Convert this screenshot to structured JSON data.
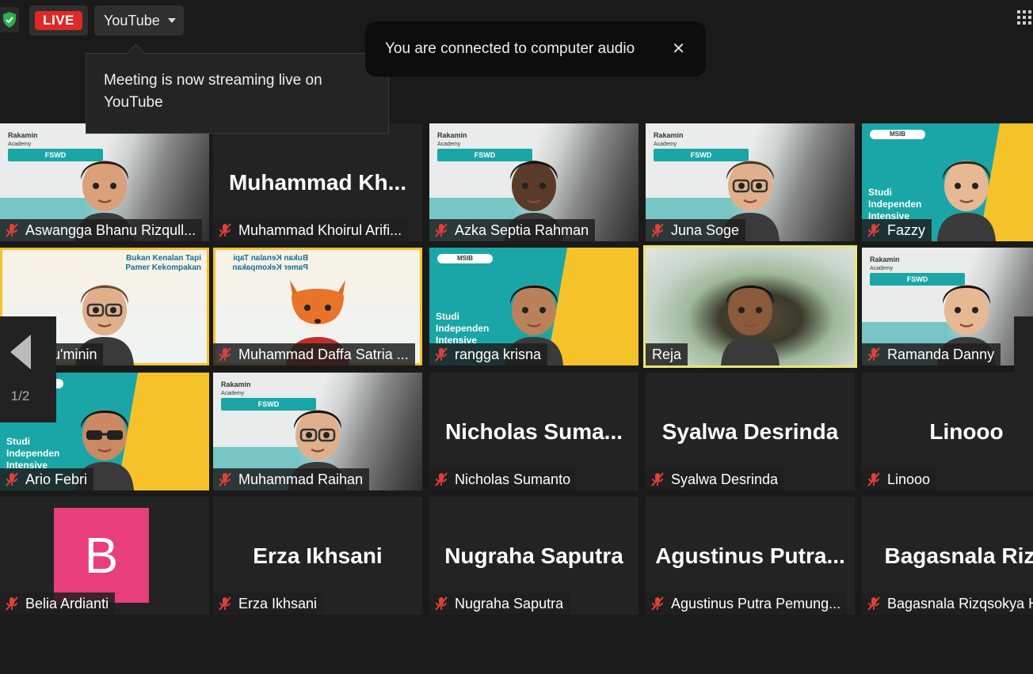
{
  "topbar": {
    "live_label": "LIVE",
    "stream_target": "YouTube"
  },
  "tooltip": {
    "text": "Meeting is now streaming live on YouTube"
  },
  "toast": {
    "text": "You are connected to computer audio",
    "close": "✕"
  },
  "pager": {
    "page": "1/2"
  },
  "slide_texts": {
    "rakamin": "Rakamin",
    "academy": "Academy",
    "fswd": "FSWD",
    "msib": "MSIB",
    "studi": "Studi Independen Intensive",
    "bukan": "Bukan Kenalan Tapi Pamer Kekompakan"
  },
  "tiles": [
    {
      "name": "Aswangga Bhanu Rizqullah",
      "label": "Aswangga Bhanu Rizqull...",
      "big": ""
    },
    {
      "name": "Muhammad Khoirul Arifin",
      "label": "Muhammad Khoirul Arifi...",
      "big": "Muhammad  Kh..."
    },
    {
      "name": "Azka Septia Rahman",
      "label": "Azka Septia Rahman",
      "big": ""
    },
    {
      "name": "Juna Soge",
      "label": "Juna Soge",
      "big": ""
    },
    {
      "name": "Fazzy",
      "label": "Fazzy",
      "big": ""
    },
    {
      "name": "ul Mu'minin",
      "label": "ul Mu'minin",
      "big": ""
    },
    {
      "name": "Muhammad Daffa Satria",
      "label": "Muhammad Daffa Satria ...",
      "big": ""
    },
    {
      "name": "rangga krisna",
      "label": "rangga krisna",
      "big": ""
    },
    {
      "name": "Reja",
      "label": "Reja",
      "big": ""
    },
    {
      "name": "Ramanda Danny",
      "label": "Ramanda Danny",
      "big": ""
    },
    {
      "name": "Ario Febri",
      "label": "Ario Febri",
      "big": ""
    },
    {
      "name": "Muhammad Raihan",
      "label": "Muhammad Raihan",
      "big": ""
    },
    {
      "name": "Nicholas Sumanto",
      "label": "Nicholas Sumanto",
      "big": "Nicholas  Suma..."
    },
    {
      "name": "Syalwa Desrinda",
      "label": "Syalwa Desrinda",
      "big": "Syalwa Desrinda"
    },
    {
      "name": "Linooo",
      "label": "Linooo",
      "big": "Linooo"
    },
    {
      "name": "Belia Ardianti",
      "label": "Belia Ardianti",
      "big": "",
      "avatar_letter": "B"
    },
    {
      "name": "Erza Ikhsani",
      "label": "Erza Ikhsani",
      "big": "Erza Ikhsani"
    },
    {
      "name": "Nugraha Saputra",
      "label": "Nugraha Saputra",
      "big": "Nugraha Saputra"
    },
    {
      "name": "Agustinus Putra Pemungkas",
      "label": "Agustinus Putra Pemung...",
      "big": "Agustinus  Putra..."
    },
    {
      "name": "Bagasnala Rizqsokya",
      "label": "Bagasnala Rizqsokya H",
      "big": "Bagasnala  Rizq"
    }
  ]
}
